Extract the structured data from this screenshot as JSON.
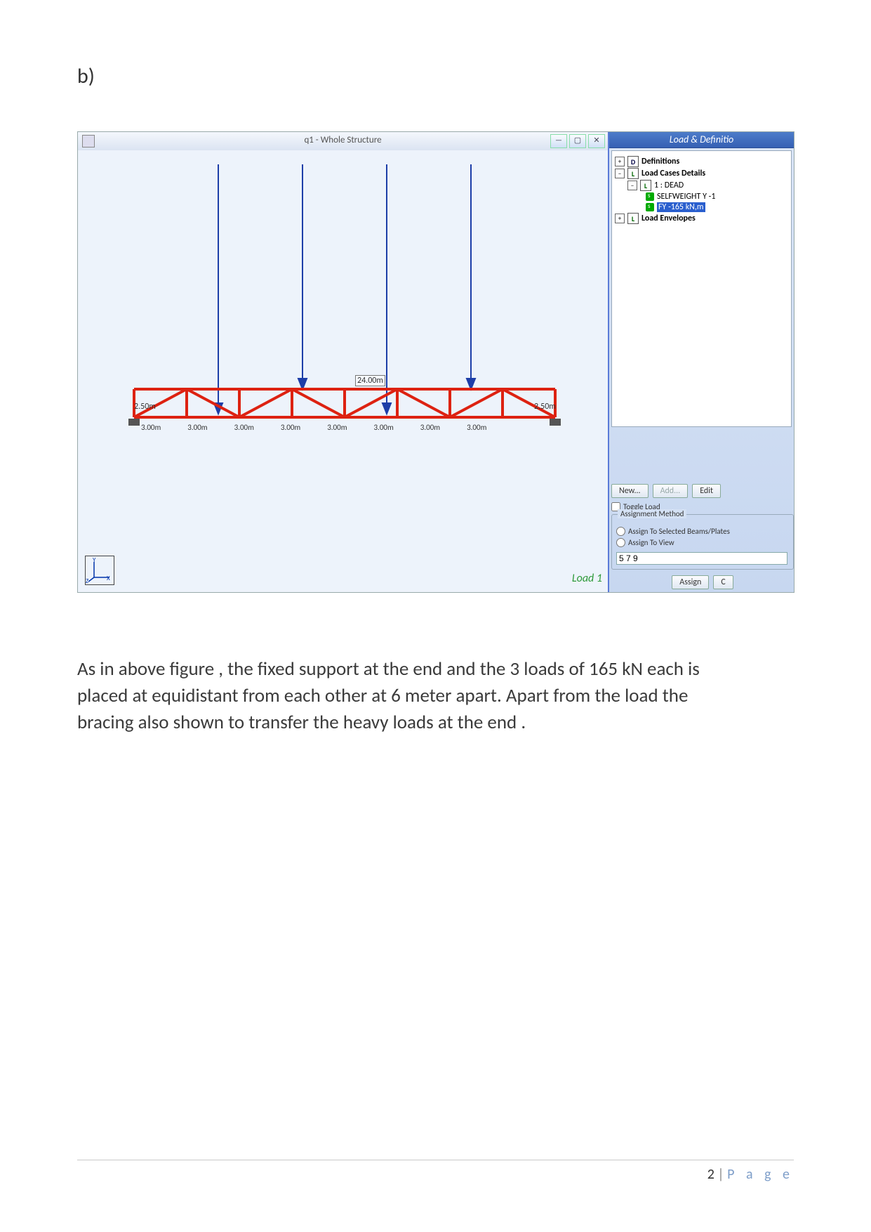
{
  "section_label": "b)",
  "screenshot": {
    "window_title": "q1 - Whole Structure",
    "win_buttons": {
      "min": "—",
      "max": "▢",
      "close": "✕"
    },
    "truss": {
      "top_span_label": "24.00m",
      "left_height": "2.50m",
      "right_height": "2.50m",
      "bay_labels": [
        "3.00m",
        "3.00m",
        "3.00m",
        "3.00m",
        "3.00m",
        "3.00m",
        "3.00m",
        "3.00m"
      ]
    },
    "axis_labels": {
      "y": "Y",
      "z": "Z",
      "x": "X"
    },
    "current_load_label": "Load 1",
    "panel_title": "Load & Definitio",
    "tree": {
      "definitions": "Definitions",
      "load_cases": "Load Cases Details",
      "case1": "1 : DEAD",
      "selfweight": "SELFWEIGHT Y -1",
      "fy": "FY -165 kN,m",
      "envelopes": "Load Envelopes"
    },
    "buttons": {
      "new": "New...",
      "add": "Add...",
      "edit": "Edit"
    },
    "toggle_label": "Toggle Load",
    "group_title": "Assignment Method",
    "radios": {
      "sel": "Assign To Selected Beams/Plates",
      "view": "Assign To View"
    },
    "input_value": "5 7 9",
    "assign_btn": "Assign",
    "close_btn": "C"
  },
  "body_text": "As in above figure , the fixed support at the end and the 3 loads of 165 kN each is placed at equidistant from each other at 6 meter apart. Apart from the load the bracing also shown to transfer the heavy loads at the end .",
  "footer": {
    "page_no": "2",
    "sep": " | ",
    "word": "P a g e"
  }
}
